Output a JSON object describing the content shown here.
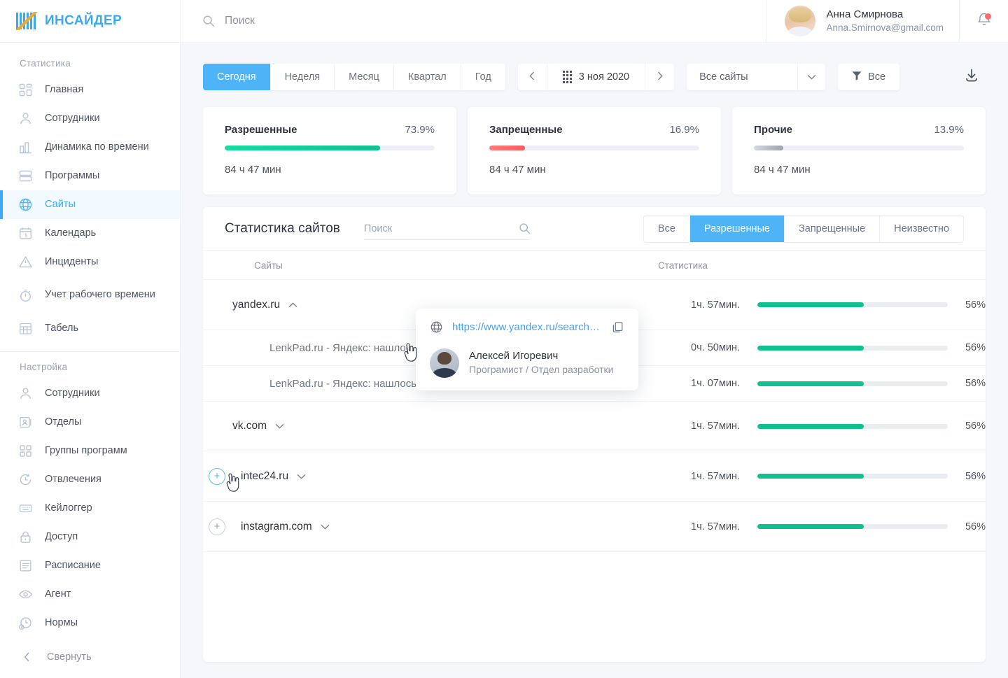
{
  "brand": {
    "name": "ИНСАЙДЕР",
    "accent": "#3aa9f0",
    "logo_icon": "insider-logo-icon"
  },
  "sidebar": {
    "groups": [
      {
        "caption": "Статистика",
        "items": [
          {
            "label": "Главная",
            "icon": "dashboard-icon",
            "active": false
          },
          {
            "label": "Сотрудники",
            "icon": "user-icon",
            "active": false
          },
          {
            "label": "Динамика по времени",
            "icon": "bar-chart-icon",
            "active": false
          },
          {
            "label": "Программы",
            "icon": "layers-icon",
            "active": false
          },
          {
            "label": "Сайты",
            "icon": "globe-icon",
            "active": true
          },
          {
            "label": "Календарь",
            "icon": "calendar-icon",
            "active": false
          },
          {
            "label": "Инциденты",
            "icon": "warning-icon",
            "active": false
          },
          {
            "label": "Учет рабочего времени",
            "icon": "stopwatch-icon",
            "active": false
          },
          {
            "label": "Табель",
            "icon": "grid-table-icon",
            "active": false
          }
        ]
      },
      {
        "caption": "Настройка",
        "items": [
          {
            "label": "Сотрудники",
            "icon": "user-icon",
            "active": false
          },
          {
            "label": "Отделы",
            "icon": "id-card-icon",
            "active": false
          },
          {
            "label": "Группы программ",
            "icon": "squares-icon",
            "active": false
          },
          {
            "label": "Отвлечения",
            "icon": "clock-reset-icon",
            "active": false
          },
          {
            "label": "Кейлоггер",
            "icon": "keyboard-icon",
            "active": false
          },
          {
            "label": "Доступ",
            "icon": "lock-icon",
            "active": false
          },
          {
            "label": "Расписание",
            "icon": "list-icon",
            "active": false
          },
          {
            "label": "Агент",
            "icon": "eye-icon",
            "active": false
          },
          {
            "label": "Нормы",
            "icon": "clock-plus-icon",
            "active": false
          }
        ]
      }
    ],
    "collapse_label": "Свернуть",
    "collapse_icon": "chevron-left-icon"
  },
  "topbar": {
    "search_placeholder": "Поиск",
    "search_value": "",
    "search_icon": "search-icon",
    "user": {
      "name": "Анна Смирнова",
      "email": "Anna.Smirnova@gmail.com",
      "avatar": "user-avatar"
    },
    "bell_icon": "bell-icon",
    "has_notification": true
  },
  "toolbar": {
    "periods": [
      {
        "label": "Сегодня",
        "selected": true
      },
      {
        "label": "Неделя",
        "selected": false
      },
      {
        "label": "Месяц",
        "selected": false
      },
      {
        "label": "Квартал",
        "selected": false
      },
      {
        "label": "Год",
        "selected": false
      }
    ],
    "date_prev_icon": "chevron-left-icon",
    "date_next_icon": "chevron-right-icon",
    "date_icon": "calendar-dots-icon",
    "date_value": "3 ноя 2020",
    "site_select_value": "Все сайты",
    "site_select_icon": "chevron-down-icon",
    "filter_label": "Все",
    "filter_icon": "funnel-icon",
    "download_icon": "download-icon"
  },
  "cards": [
    {
      "title": "Разрешенные",
      "percent": "73.9%",
      "value": 73.9,
      "time": "84 ч 47 мин",
      "color": "#0fc18e",
      "style": "green"
    },
    {
      "title": "Запрещенные",
      "percent": "16.9%",
      "value": 16.9,
      "time": "84 ч 47 мин",
      "color": "#f95d5d",
      "style": "red"
    },
    {
      "title": "Прочие",
      "percent": "13.9%",
      "value": 13.9,
      "time": "84 ч 47 мин",
      "color": "#9aa2ae",
      "style": "gray"
    }
  ],
  "panel": {
    "title": "Статистика сайтов",
    "search_placeholder": "Поиск",
    "search_value": "",
    "search_icon": "search-icon",
    "tabs": [
      {
        "label": "Все",
        "selected": false
      },
      {
        "label": "Разрешенные",
        "selected": true
      },
      {
        "label": "Запрещенные",
        "selected": false
      },
      {
        "label": "Неизвестно",
        "selected": false
      }
    ],
    "columns": {
      "site": "Сайты",
      "stat": "Статистика"
    },
    "rows": [
      {
        "name": "yandex.ru",
        "child": false,
        "expanded": true,
        "chevron": "chevron-up-icon",
        "plus": false,
        "plus_hover": false,
        "time": "1ч. 57мин.",
        "percent": "56%",
        "value": 56,
        "height": "h-lg"
      },
      {
        "name": "LenkPad.ru - Яндекс: нашлось 7 млн. изображений",
        "child": true,
        "expanded": false,
        "chevron": "",
        "plus": false,
        "plus_hover": false,
        "time": "0ч. 50мин.",
        "percent": "56%",
        "value": 56,
        "height": "h-sm"
      },
      {
        "name": "LenkPad.ru - Яндекс: нашлось 7 млн. изображений",
        "child": true,
        "expanded": false,
        "chevron": "",
        "plus": false,
        "plus_hover": false,
        "time": "1ч. 07мин.",
        "percent": "56%",
        "value": 56,
        "height": "h-sm"
      },
      {
        "name": "vk.com",
        "child": false,
        "expanded": false,
        "chevron": "chevron-down-icon",
        "plus": false,
        "plus_hover": false,
        "time": "1ч. 57мин.",
        "percent": "56%",
        "value": 56,
        "height": "h-xl"
      },
      {
        "name": "intec24.ru",
        "child": false,
        "expanded": false,
        "chevron": "chevron-down-icon",
        "plus": true,
        "plus_hover": true,
        "time": "1ч. 57мин.",
        "percent": "56%",
        "value": 56,
        "height": "h-lg"
      },
      {
        "name": "instagram.com",
        "child": false,
        "expanded": false,
        "chevron": "chevron-down-icon",
        "plus": true,
        "plus_hover": false,
        "time": "1ч. 57мин.",
        "percent": "56%",
        "value": 56,
        "height": "h-lg"
      }
    ]
  },
  "popover": {
    "url": "https://www.yandex.ru/search…",
    "url_icon": "globe-icon",
    "copy_icon": "copy-icon",
    "person_name": "Алексей Игоревич",
    "person_role": "Програмист / Отдел разработки",
    "person_avatar": "person-avatar"
  },
  "plus_label": "+"
}
